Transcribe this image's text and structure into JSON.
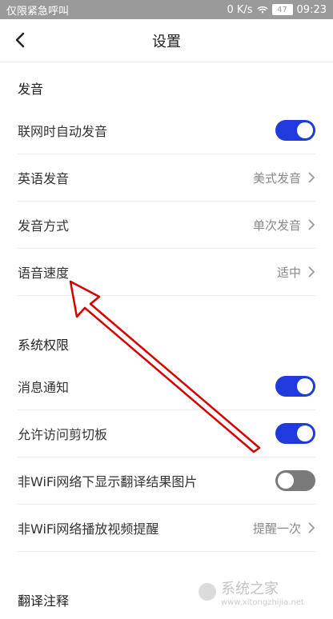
{
  "statusbar": {
    "left_text": "仅限紧急呼叫",
    "speed": "0 K/s",
    "battery": "47",
    "time": "09:23"
  },
  "header": {
    "title": "设置"
  },
  "sections": [
    {
      "title": "发音",
      "rows": [
        {
          "label": "联网时自动发音",
          "type": "toggle",
          "state": "on"
        },
        {
          "label": "英语发音",
          "type": "value",
          "value": "美式发音"
        },
        {
          "label": "发音方式",
          "type": "value",
          "value": "单次发音"
        },
        {
          "label": "语音速度",
          "type": "value",
          "value": "适中"
        }
      ]
    },
    {
      "title": "系统权限",
      "rows": [
        {
          "label": "消息通知",
          "type": "toggle",
          "state": "on"
        },
        {
          "label": "允许访问剪切板",
          "type": "toggle",
          "state": "on"
        },
        {
          "label": "非WiFi网络下显示翻译结果图片",
          "type": "toggle",
          "state": "off"
        },
        {
          "label": "非WiFi网络播放视频提醒",
          "type": "value",
          "value": "提醒一次"
        }
      ]
    },
    {
      "title": "翻译注释",
      "rows": []
    }
  ],
  "watermark": {
    "text": "系统之家",
    "url": "www.xitongzhijia.net"
  },
  "colors": {
    "toggle_on": "#1f3bdb",
    "toggle_off": "#7a7a7a",
    "arrow": "#d40000"
  },
  "icons": {
    "back": "chevron-left-icon",
    "row_arrow": "chevron-right-icon"
  }
}
